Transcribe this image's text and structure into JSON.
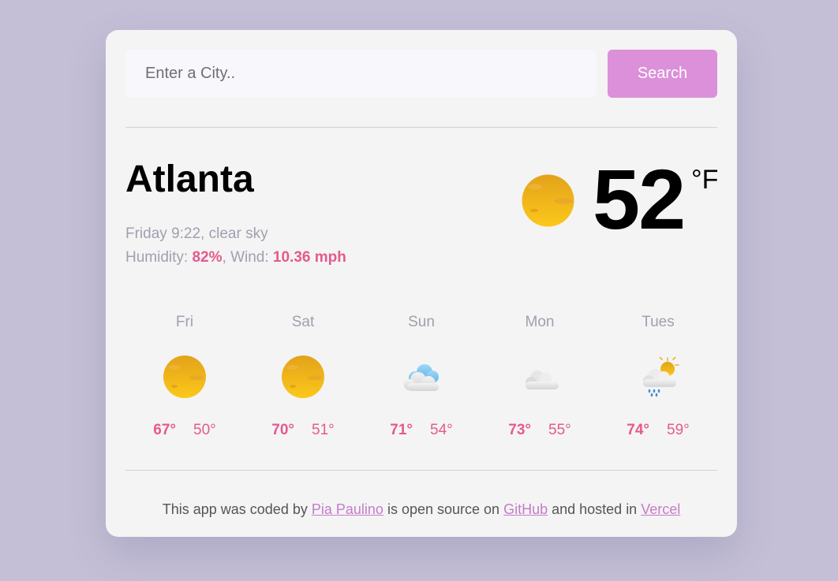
{
  "search": {
    "placeholder": "Enter a City..",
    "button_label": "Search"
  },
  "current": {
    "city": "Atlanta",
    "datetime": "Friday 9:22",
    "description": "clear sky",
    "humidity_label": "Humidity:",
    "humidity_value": "82%",
    "wind_label": "Wind:",
    "wind_value": "10.36 mph",
    "temperature": "52",
    "unit": "°F",
    "icon": "clear-sky-icon"
  },
  "forecast": [
    {
      "day": "Fri",
      "max": "67°",
      "min": "50°",
      "icon": "clear-sky-icon"
    },
    {
      "day": "Sat",
      "max": "70°",
      "min": "51°",
      "icon": "clear-sky-icon"
    },
    {
      "day": "Sun",
      "max": "71°",
      "min": "54°",
      "icon": "few-clouds-icon"
    },
    {
      "day": "Mon",
      "max": "73°",
      "min": "55°",
      "icon": "overcast-clouds-icon"
    },
    {
      "day": "Tues",
      "max": "74°",
      "min": "59°",
      "icon": "rain-sun-icon"
    }
  ],
  "footer": {
    "text1": "This app was coded by",
    "author": "Pia Paulino",
    "text2": "is open source on",
    "github": "GitHub",
    "text3": "and hosted in",
    "host": "Vercel"
  },
  "colors": {
    "accent": "#db90d9",
    "highlight": "#e45a8e",
    "link": "#c47cc9",
    "background": "#c4bfd6"
  }
}
